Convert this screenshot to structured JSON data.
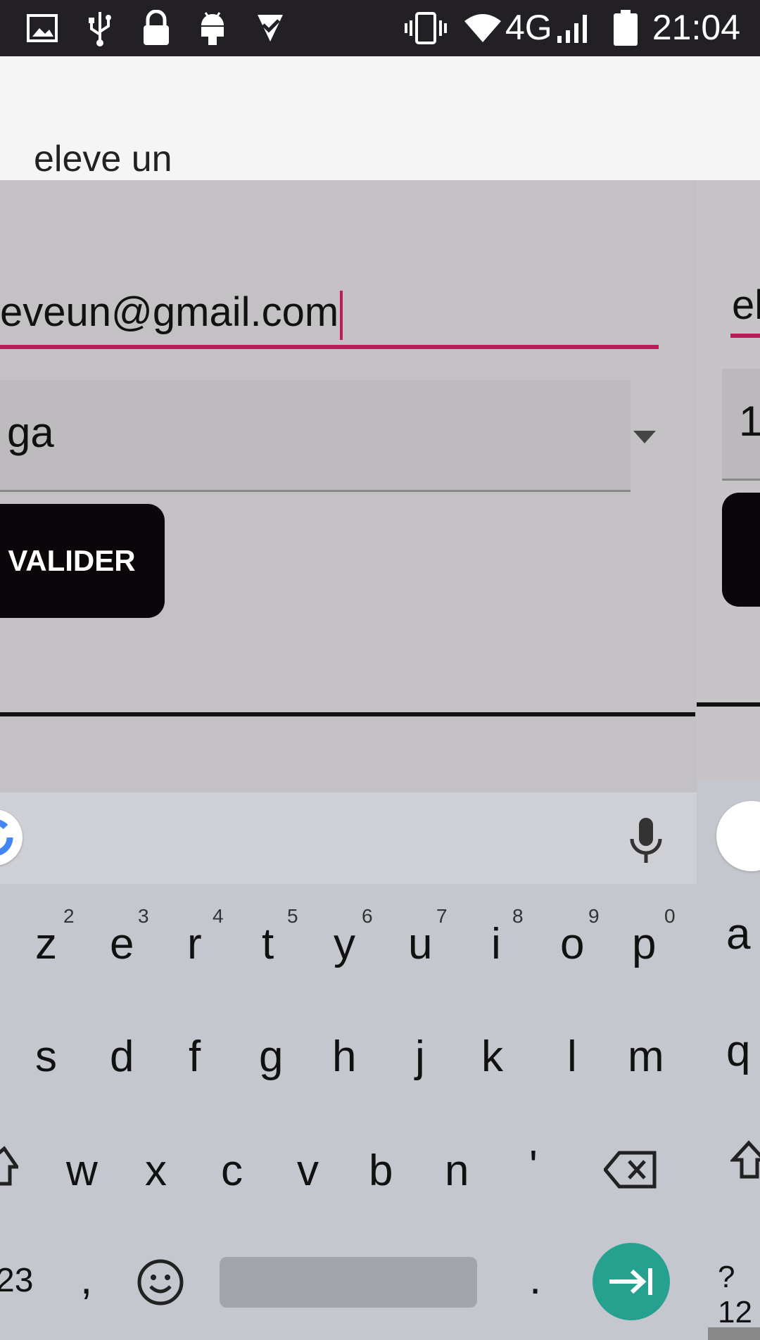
{
  "status_bar": {
    "icons": [
      "image-icon",
      "usb-icon",
      "lock-icon",
      "android-icon",
      "check-icon",
      "vibrate-icon",
      "wifi-icon",
      "signal-icon",
      "battery-icon"
    ],
    "network": "4G",
    "time": "21:04"
  },
  "form": {
    "name_value": "eleve un",
    "email_value": "eveun@gmail.com",
    "select_value": "ga",
    "submit_label": "VALIDER"
  },
  "ghost": {
    "email_partial": "el",
    "select_partial": "1"
  },
  "keyboard": {
    "row1": [
      {
        "key": "z",
        "hint": "2"
      },
      {
        "key": "e",
        "hint": "3"
      },
      {
        "key": "r",
        "hint": "4"
      },
      {
        "key": "t",
        "hint": "5"
      },
      {
        "key": "y",
        "hint": "6"
      },
      {
        "key": "u",
        "hint": "7"
      },
      {
        "key": "i",
        "hint": "8"
      },
      {
        "key": "o",
        "hint": "9"
      },
      {
        "key": "p",
        "hint": "0"
      }
    ],
    "row2": [
      "s",
      "d",
      "f",
      "g",
      "h",
      "j",
      "k",
      "l",
      "m"
    ],
    "row3": [
      "w",
      "x",
      "c",
      "v",
      "b",
      "n",
      "'"
    ],
    "bottom": {
      "numbers": "23",
      "comma": ",",
      "period": "."
    },
    "ghost_letters": [
      "a",
      "q",
      "?12"
    ]
  }
}
